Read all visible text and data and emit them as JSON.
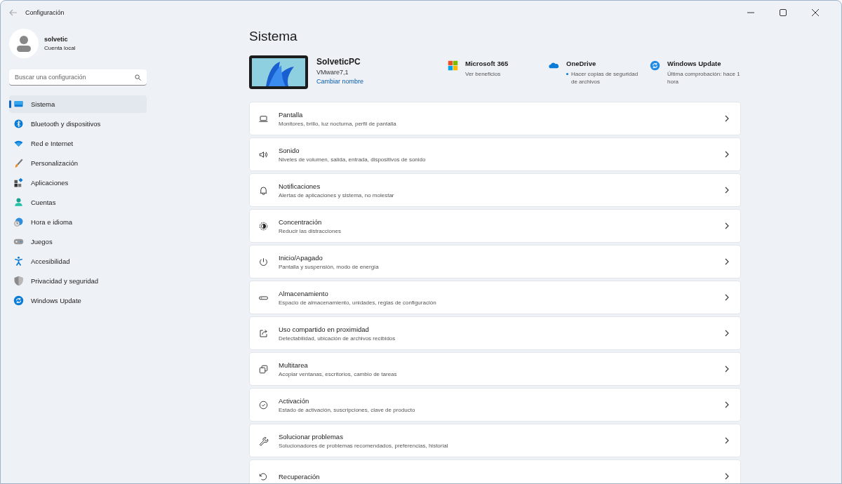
{
  "window": {
    "title": "Configuración"
  },
  "account": {
    "name": "solvetic",
    "type": "Cuenta local"
  },
  "search": {
    "placeholder": "Buscar una configuración"
  },
  "sidebar": {
    "items": [
      {
        "label": "Sistema",
        "selected": true
      },
      {
        "label": "Bluetooth y dispositivos",
        "selected": false
      },
      {
        "label": "Red e Internet",
        "selected": false
      },
      {
        "label": "Personalización",
        "selected": false
      },
      {
        "label": "Aplicaciones",
        "selected": false
      },
      {
        "label": "Cuentas",
        "selected": false
      },
      {
        "label": "Hora e idioma",
        "selected": false
      },
      {
        "label": "Juegos",
        "selected": false
      },
      {
        "label": "Accesibilidad",
        "selected": false
      },
      {
        "label": "Privacidad y seguridad",
        "selected": false
      },
      {
        "label": "Windows Update",
        "selected": false
      }
    ]
  },
  "page_title": "Sistema",
  "device": {
    "name": "SolveticPC",
    "model": "VMware7,1",
    "rename_link": "Cambiar nombre"
  },
  "quick_links": [
    {
      "title": "Microsoft 365",
      "subtitle": "Ver beneficios",
      "dot": false
    },
    {
      "title": "OneDrive",
      "subtitle": "Hacer copias de seguridad de archivos",
      "dot": true
    },
    {
      "title": "Windows Update",
      "subtitle": "Última comprobación: hace 1 hora",
      "dot": false
    }
  ],
  "settings": [
    {
      "title": "Pantalla",
      "description": "Monitores, brillo, luz nocturna, perfil de pantalla"
    },
    {
      "title": "Sonido",
      "description": "Niveles de volumen, salida, entrada, dispositivos de sonido"
    },
    {
      "title": "Notificaciones",
      "description": "Alertas de aplicaciones y sistema, no molestar"
    },
    {
      "title": "Concentración",
      "description": "Reducir las distracciones"
    },
    {
      "title": "Inicio/Apagado",
      "description": "Pantalla y suspensión, modo de energía"
    },
    {
      "title": "Almacenamiento",
      "description": "Espacio de almacenamiento, unidades, reglas de configuración"
    },
    {
      "title": "Uso compartido en proximidad",
      "description": "Detectabilidad, ubicación de archivos recibidos"
    },
    {
      "title": "Multitarea",
      "description": "Acoplar ventanas, escritorios, cambio de tareas"
    },
    {
      "title": "Activación",
      "description": "Estado de activación, suscripciones, clave de producto"
    },
    {
      "title": "Solucionar problemas",
      "description": "Solucionadores de problemas recomendados, preferencias, historial"
    },
    {
      "title": "Recuperación"
    }
  ]
}
